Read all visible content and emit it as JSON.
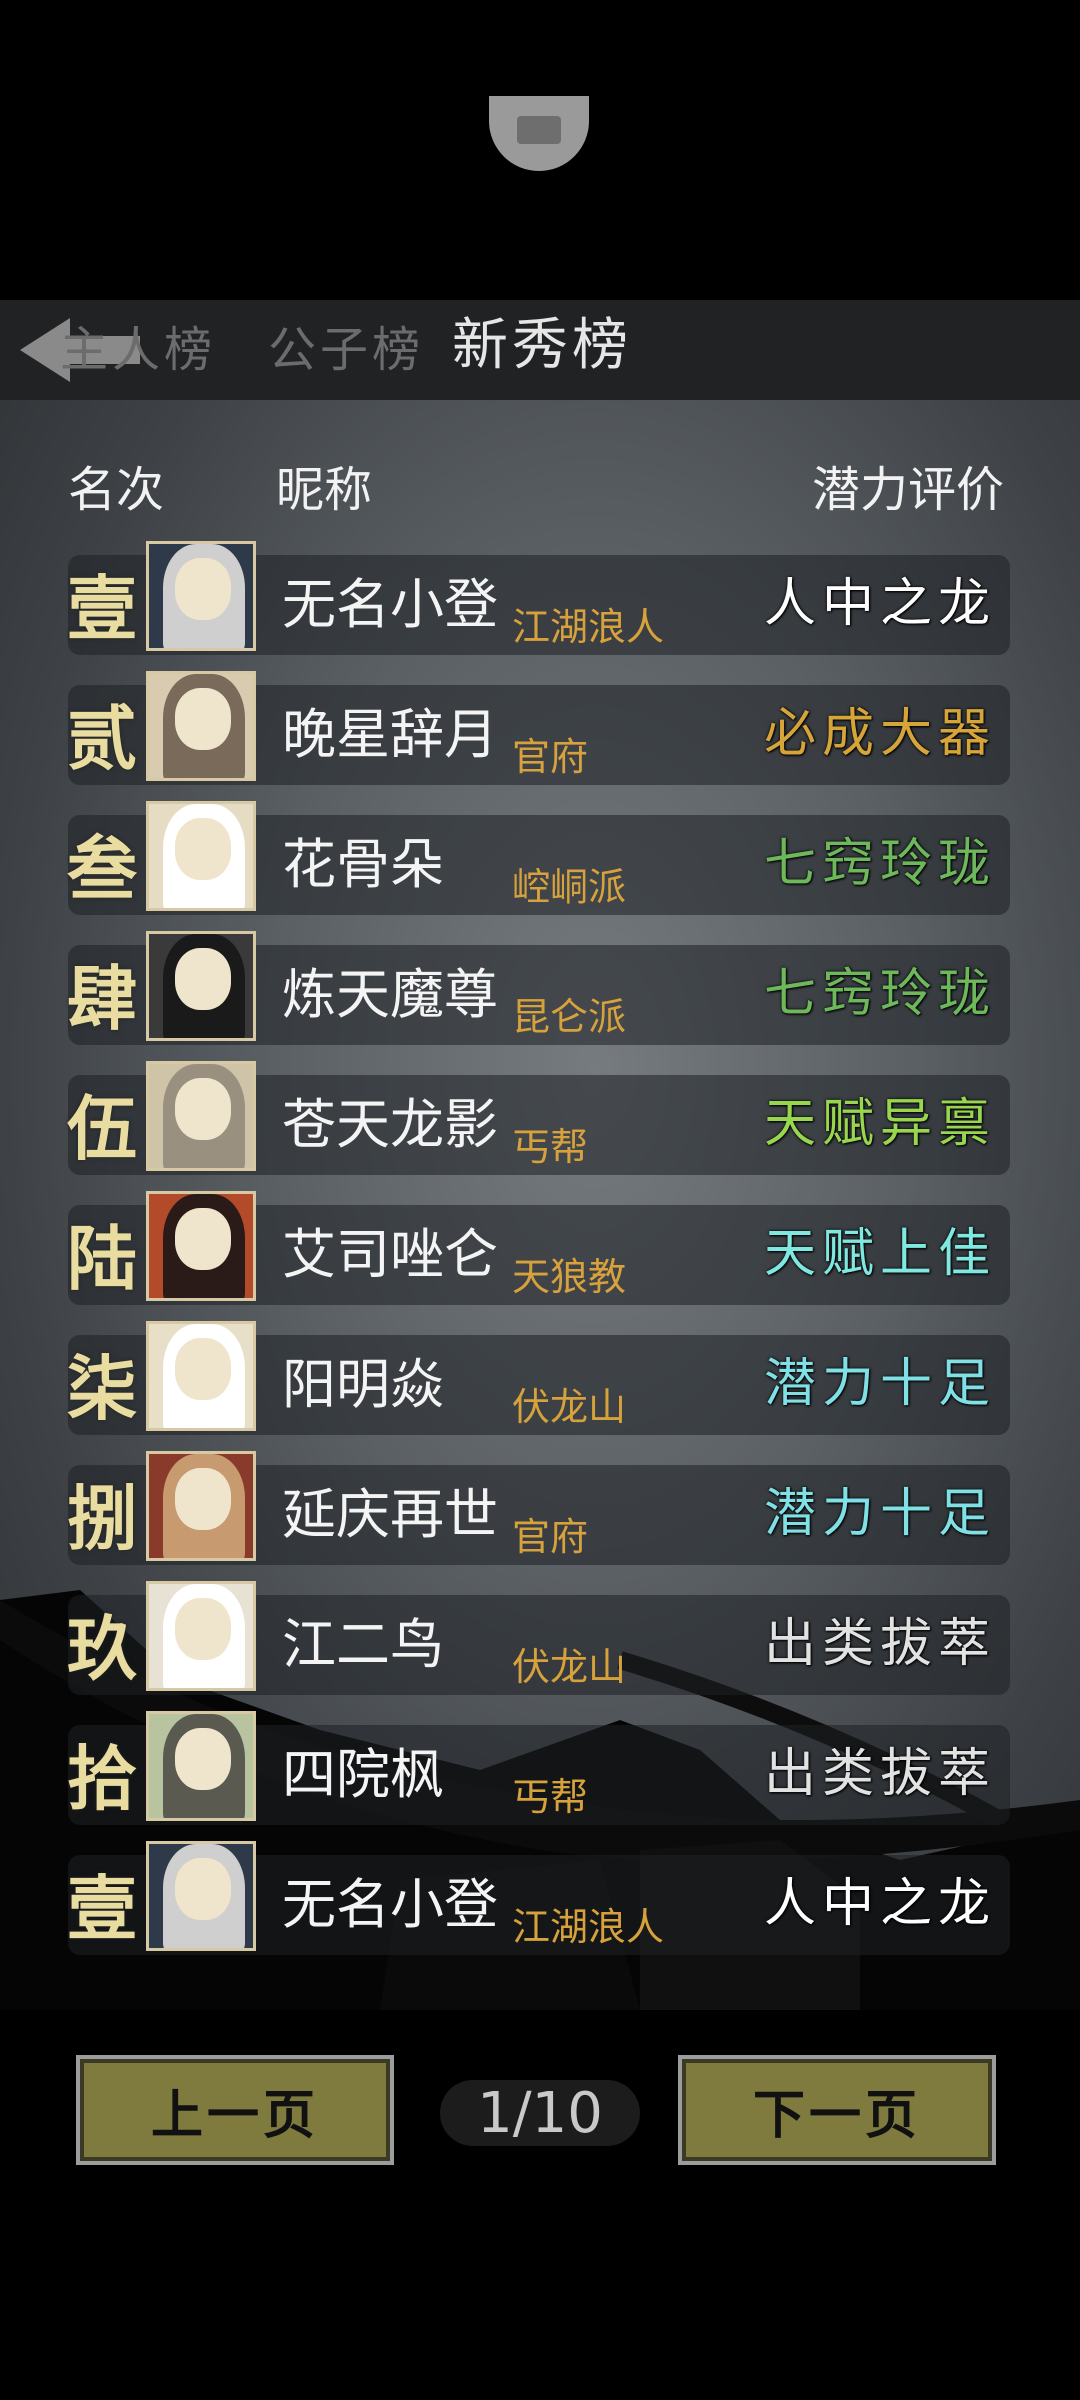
{
  "tabs": [
    {
      "label": "主人榜",
      "active": false
    },
    {
      "label": "公子榜",
      "active": false
    },
    {
      "label": "新秀榜",
      "active": true
    }
  ],
  "headers": {
    "rank": "名次",
    "nickname": "昵称",
    "potential": "潜力评价"
  },
  "rows": [
    {
      "rank": "壹",
      "name": "无名小登",
      "faction": "江湖浪人",
      "potential": "人中之龙",
      "potential_color": "#ffffff"
    },
    {
      "rank": "贰",
      "name": "晚星辞月",
      "faction": "官府",
      "potential": "必成大器",
      "potential_color": "#d6a53a"
    },
    {
      "rank": "叁",
      "name": "花骨朵",
      "faction": "崆峒派",
      "potential": "七窍玲珑",
      "potential_color": "#6db85a"
    },
    {
      "rank": "肆",
      "name": "炼天魔尊",
      "faction": "昆仑派",
      "potential": "七窍玲珑",
      "potential_color": "#6db85a"
    },
    {
      "rank": "伍",
      "name": "苍天龙影",
      "faction": "丐帮",
      "potential": "天赋异禀",
      "potential_color": "#98d64e"
    },
    {
      "rank": "陆",
      "name": "艾司唑仑",
      "faction": "天狼教",
      "potential": "天赋上佳",
      "potential_color": "#7fe8e0"
    },
    {
      "rank": "柒",
      "name": "阳明焱",
      "faction": "伏龙山",
      "potential": "潜力十足",
      "potential_color": "#7fe0e6"
    },
    {
      "rank": "捌",
      "name": "延庆再世",
      "faction": "官府",
      "potential": "潜力十足",
      "potential_color": "#7fe0e6"
    },
    {
      "rank": "玖",
      "name": "江二鸟",
      "faction": "伏龙山",
      "potential": "出类拔萃",
      "potential_color": "#e2e2e2"
    },
    {
      "rank": "拾",
      "name": "四院枫",
      "faction": "丐帮",
      "potential": "出类拔萃",
      "potential_color": "#e2e2e2"
    }
  ],
  "self_row": {
    "rank": "壹",
    "name": "无名小登",
    "faction": "江湖浪人",
    "potential": "人中之龙",
    "potential_color": "#ffffff"
  },
  "pagination": {
    "prev_label": "上一页",
    "next_label": "下一页",
    "indicator": "1/10"
  },
  "icons": {
    "back": "back-arrow-icon",
    "avatar": "character-portrait-icon"
  }
}
